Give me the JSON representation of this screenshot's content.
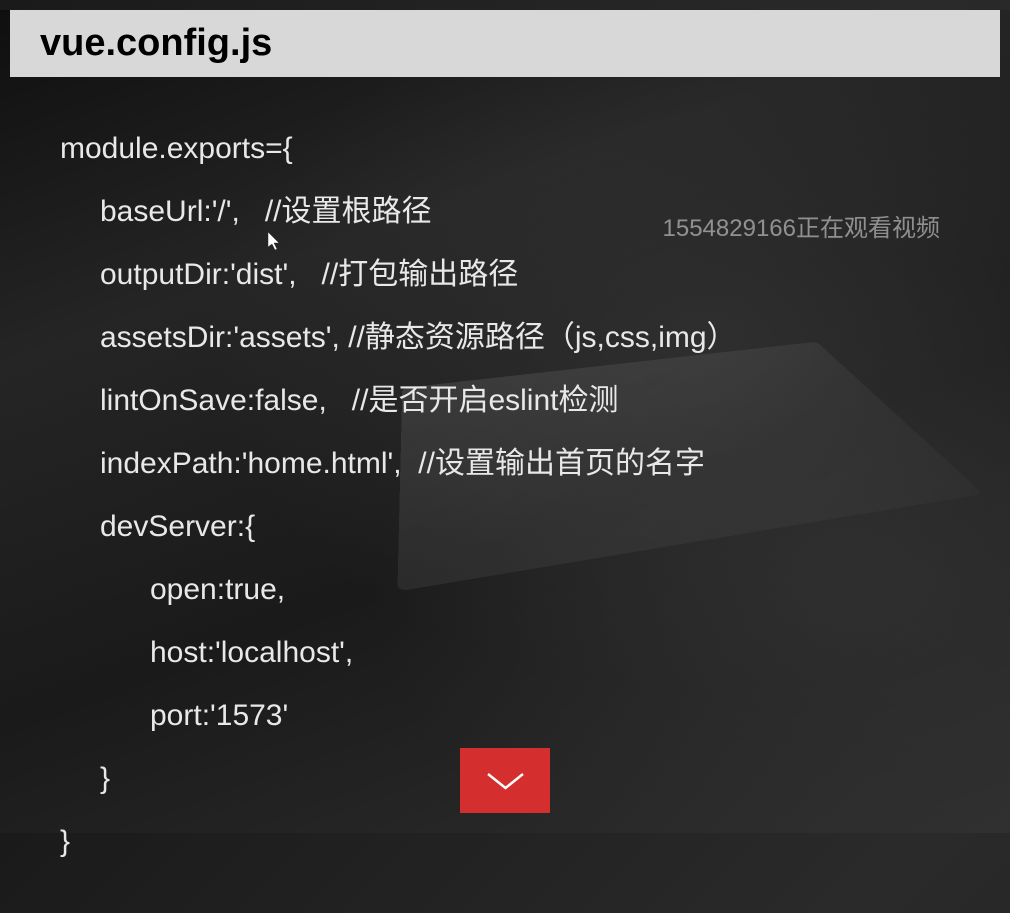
{
  "title": "vue.config.js",
  "watermark": "1554829166正在观看视频",
  "code": {
    "line1": "module.exports={",
    "line2": "baseUrl:'/',   //设置根路径",
    "line3": "outputDir:'dist',   //打包输出路径",
    "line4": "assetsDir:'assets', //静态资源路径（js,css,img）",
    "line5": "lintOnSave:false,   //是否开启eslint检测",
    "line6": "indexPath:'home.html',  //设置输出首页的名字",
    "line7": "devServer:{",
    "line8": "open:true,",
    "line9": "host:'localhost',",
    "line10": "port:'1573'",
    "line11": "}",
    "line12": "}"
  }
}
